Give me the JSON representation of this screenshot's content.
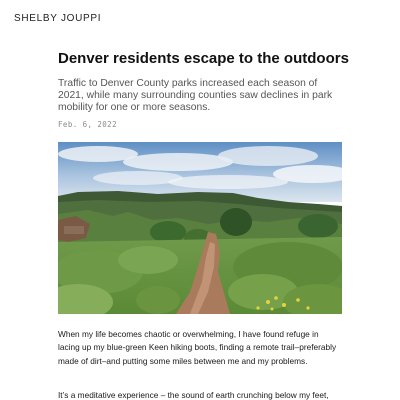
{
  "site": {
    "name": "SHELBY JOUPPI"
  },
  "article": {
    "title": "Denver residents escape to the outdoors",
    "subtitle": "Traffic to Denver County parks increased each season of 2021, while many surrounding counties saw declines in park mobility for one or more seasons.",
    "date": "Feb. 6, 2022",
    "hero_image": {
      "depicts": "dirt trail through green grass and shrubs toward distant mesa under a partly cloudy sky"
    },
    "paragraphs": [
      "When my life becomes chaotic or overwhelming, I have found refuge in lacing up my blue-green Keen hiking boots, finding a remote trail–preferably made of dirt–and putting some miles between me and my problems.",
      "It’s a meditative experience – the sound of earth crunching below my feet,"
    ]
  },
  "colors": {
    "text": "#111111",
    "subtitle": "#555555",
    "date": "#8a8a8a",
    "background": "#ffffff"
  }
}
